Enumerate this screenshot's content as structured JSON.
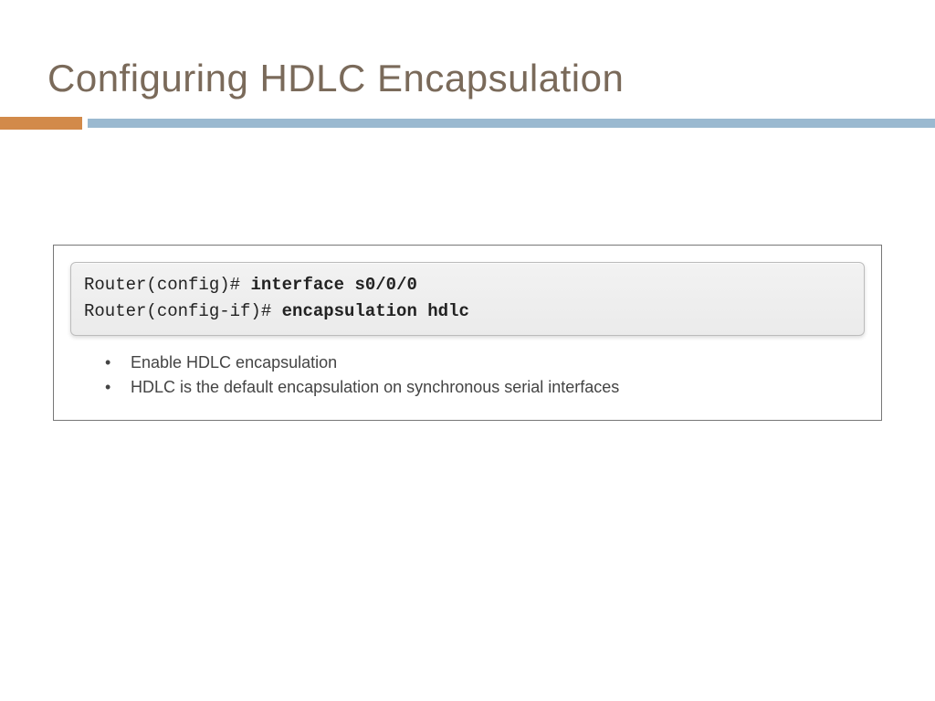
{
  "title": "Configuring HDLC Encapsulation",
  "terminal": {
    "line1_prompt": "Router(config)# ",
    "line1_cmd": "interface s0/0/0",
    "line2_prompt": "Router(config-if)# ",
    "line2_cmd": "encapsulation hdlc"
  },
  "bullets": [
    "Enable HDLC encapsulation",
    "HDLC is the default encapsulation on synchronous serial interfaces"
  ]
}
